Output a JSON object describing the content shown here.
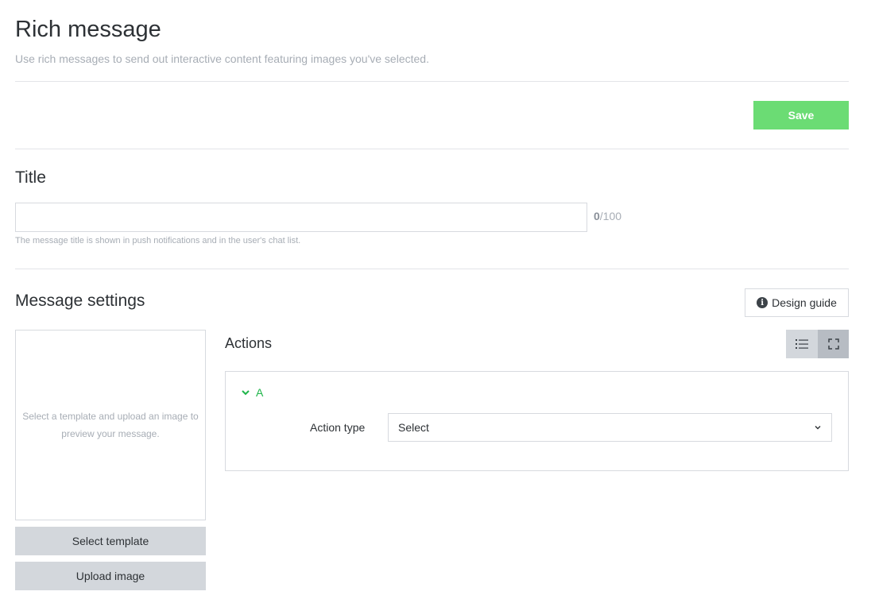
{
  "header": {
    "title": "Rich message",
    "subtitle": "Use rich messages to send out interactive content featuring images you've selected."
  },
  "toolbar": {
    "save_label": "Save"
  },
  "title_section": {
    "heading": "Title",
    "input_value": "",
    "counter_current": "0",
    "counter_max": "/100",
    "helper": "The message title is shown in push notifications and in the user's chat list."
  },
  "message_settings": {
    "heading": "Message settings",
    "design_guide_label": "Design guide",
    "preview_text": "Select a template and upload an image to preview your message.",
    "select_template_label": "Select template",
    "upload_image_label": "Upload image",
    "actions_heading": "Actions",
    "view_toggle": {
      "options": [
        "list-view",
        "fullscreen-view"
      ],
      "selected": "fullscreen-view"
    },
    "actions": [
      {
        "label": "A",
        "expanded": true,
        "action_type_label": "Action type",
        "action_type_value": "Select"
      }
    ]
  },
  "colors": {
    "save_button": "#6bdc74",
    "accent_green": "#1fb54a",
    "muted_text": "#a7adb5",
    "gray_button": "#d3d7dc"
  }
}
